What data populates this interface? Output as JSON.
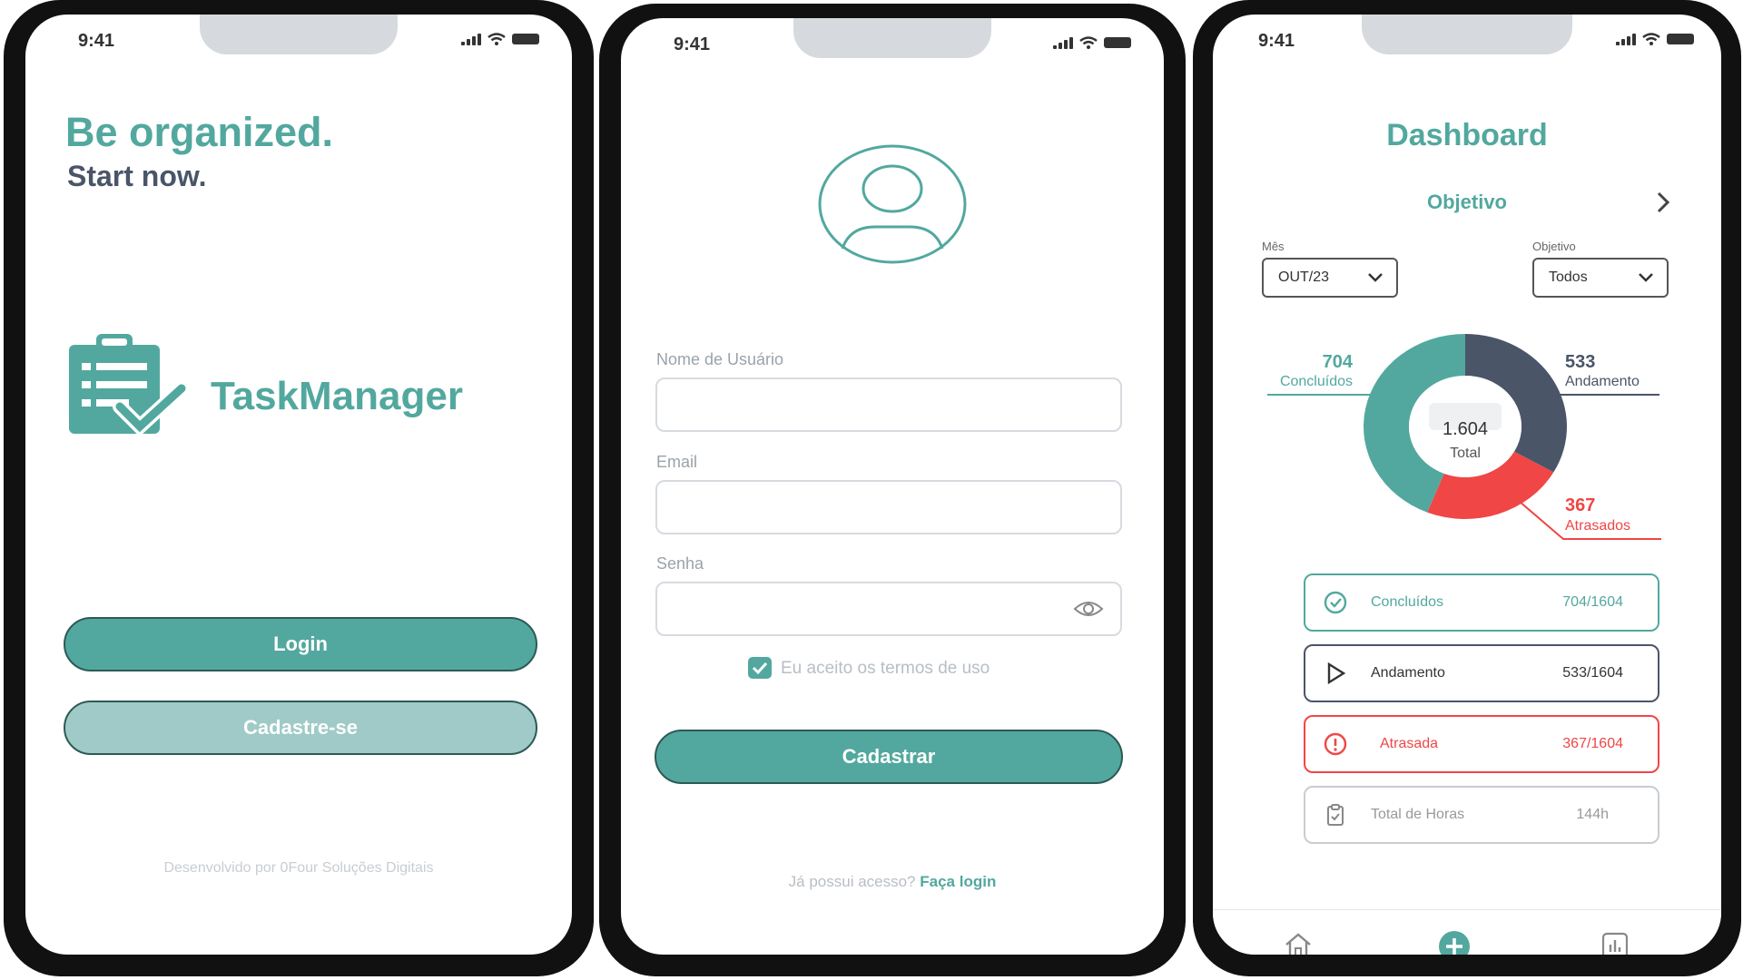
{
  "status_bar": {
    "time": "9:41"
  },
  "welcome": {
    "headline": "Be organized.",
    "subheadline": "Start now.",
    "app_name": "TaskManager",
    "login_button": "Login",
    "signup_button": "Cadastre-se",
    "footer": "Desenvolvido por 0Four Soluções Digitais"
  },
  "register": {
    "username_label": "Nome de Usuário",
    "email_label": "Email",
    "password_label": "Senha",
    "terms_label": "Eu aceito os termos de uso",
    "terms_checked": true,
    "submit_button": "Cadastrar",
    "have_account_text": "Já possui acesso?",
    "login_link": "Faça login"
  },
  "dashboard": {
    "title": "Dashboard",
    "section": "Objetivo",
    "month_label": "Mês",
    "month_value": "OUT/23",
    "objective_label": "Objetivo",
    "objective_value": "Todos",
    "total_value": "1.604",
    "total_label": "Total",
    "legend": {
      "done": {
        "value": "704",
        "label": "Concluídos"
      },
      "progress": {
        "value": "533",
        "label": "Andamento"
      },
      "late": {
        "value": "367",
        "label": "Atrasados"
      }
    },
    "rows": [
      {
        "name": "Concluídos",
        "value": "704/1604"
      },
      {
        "name": "Andamento",
        "value": "533/1604"
      },
      {
        "name": "Atrasada",
        "value": "367/1604"
      },
      {
        "name": "Total de Horas",
        "value": "144h"
      }
    ],
    "nav": [
      "home-icon",
      "add-icon",
      "chart-icon"
    ]
  },
  "chart_data": {
    "type": "pie",
    "categories": [
      "Concluídos",
      "Andamento",
      "Atrasados"
    ],
    "values": [
      704,
      533,
      367
    ],
    "colors": [
      "#52a89e",
      "#4a5568",
      "#f04646"
    ],
    "total": 1604
  },
  "colors": {
    "accent": "#52a89e",
    "accent_light": "#9fcac7",
    "dark": "#4a5568",
    "danger": "#f04646"
  }
}
